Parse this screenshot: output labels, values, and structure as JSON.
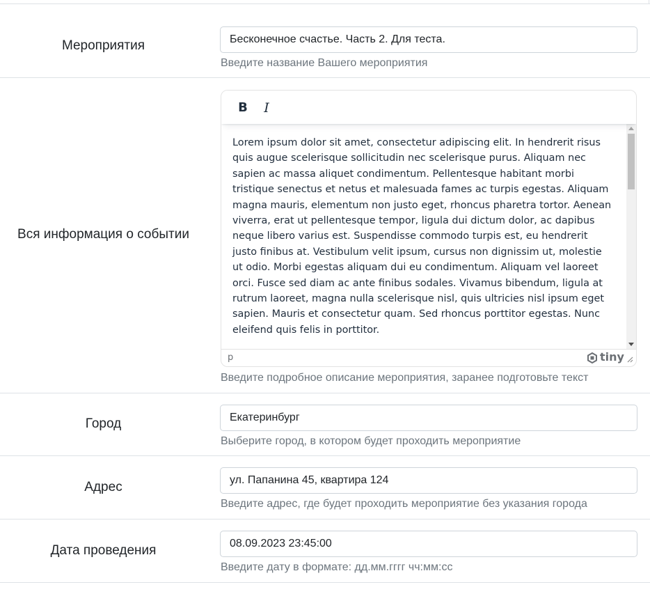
{
  "rows": {
    "event": {
      "label": "Мероприятия",
      "value": "Бесконечное счастье. Часть 2. Для теста.",
      "help": "Введите название Вашего мероприятия"
    },
    "info": {
      "label": "Вся информация о событии",
      "editor": {
        "bold_label": "B",
        "italic_label": "I",
        "content": "Lorem ipsum dolor sit amet, consectetur adipiscing elit. In hendrerit risus quis augue scelerisque sollicitudin nec scelerisque purus. Aliquam nec sapien ac massa aliquet condimentum. Pellentesque habitant morbi tristique senectus et netus et malesuada fames ac turpis egestas. Aliquam magna mauris, elementum non justo eget, rhoncus pharetra tortor. Aenean viverra, erat ut pellentesque tempor, ligula dui dictum dolor, ac dapibus neque libero varius est. Suspendisse commodo turpis est, eu hendrerit justo finibus at. Vestibulum velit ipsum, cursus non dignissim ut, molestie ut odio. Morbi egestas aliquam dui eu condimentum. Aliquam vel laoreet orci. Fusce sed diam ac ante finibus sodales. Vivamus bibendum, ligula at rutrum laoreet, magna nulla scelerisque nisl, quis ultricies nisl ipsum eget sapien. Mauris et consectetur quam. Sed rhoncus porttitor egestas. Nunc eleifend quis felis in porttitor.",
        "path": "p",
        "brand": "tiny"
      },
      "help": "Введите подробное описание мероприятия, заранее подготовьте текст"
    },
    "city": {
      "label": "Город",
      "value": "Екатеринбург",
      "help": "Выберите город, в котором будет проходить мероприятие"
    },
    "address": {
      "label": "Адрес",
      "value": "ул. Папанина 45, квартира 124",
      "help": "Введите адрес, где будет проходить мероприятие без указания города"
    },
    "date": {
      "label": "Дата проведения",
      "value": "08.09.2023 23:45:00",
      "help": "Введите дату в формате: дд.мм.гггг чч:мм:сс"
    }
  },
  "colors": {
    "border": "#ced4da",
    "divider": "#dee2e6",
    "help_text": "#6c757d",
    "text": "#212529"
  }
}
